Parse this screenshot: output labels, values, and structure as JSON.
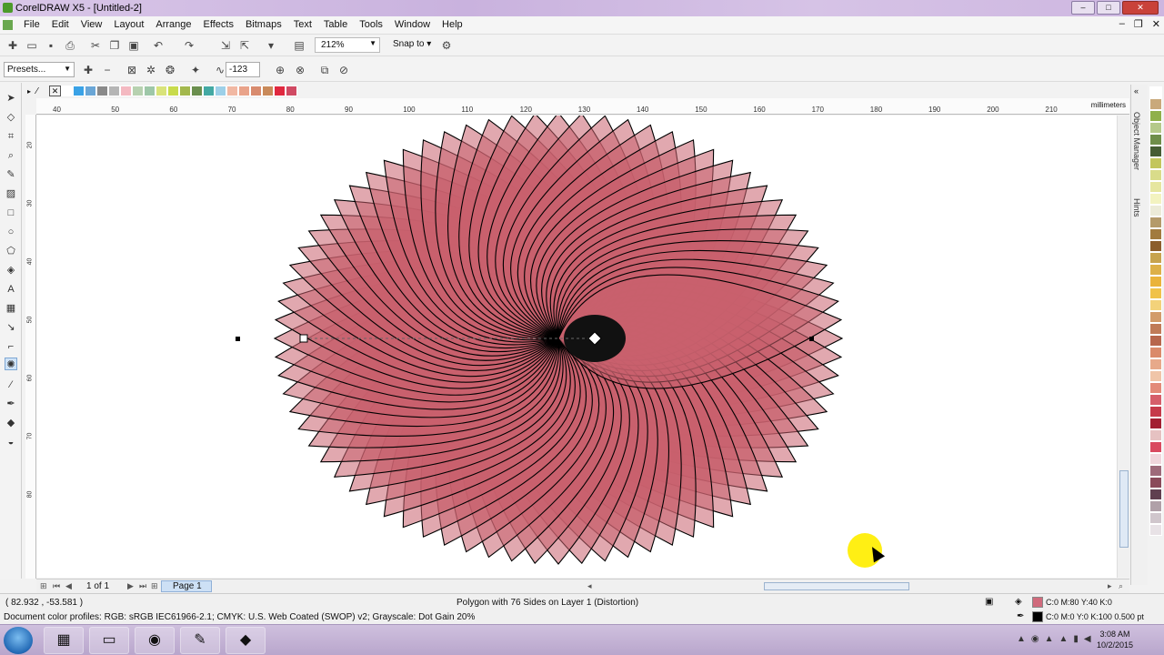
{
  "window": {
    "title": "CorelDRAW X5 - [Untitled-2]"
  },
  "menu": [
    "File",
    "Edit",
    "View",
    "Layout",
    "Arrange",
    "Effects",
    "Bitmaps",
    "Text",
    "Table",
    "Tools",
    "Window",
    "Help"
  ],
  "standard_toolbar": {
    "zoom": "212%",
    "snap_to": "Snap to"
  },
  "property_bar": {
    "presets": "Presets...",
    "distortion_value": "-123"
  },
  "rulers": {
    "unit": "millimeters",
    "h_ticks": [
      "40",
      "50",
      "60",
      "70",
      "80",
      "90",
      "100",
      "110",
      "120",
      "130",
      "140",
      "150",
      "160",
      "170",
      "180",
      "190",
      "200",
      "210"
    ],
    "v_ticks": [
      "20",
      "30",
      "40",
      "50",
      "60",
      "70",
      "80"
    ]
  },
  "document_palette": [
    "#ffffff",
    "#3aa2e6",
    "#6aa6d6",
    "#8a8a8a",
    "#b5b5b5",
    "#f4b9c1",
    "#b7d1b0",
    "#9ec7a8",
    "#d9e37a",
    "#c8db4c",
    "#a3b84d",
    "#6b8f4e",
    "#43a9a3",
    "#9dd0e8",
    "#f1b8a3",
    "#e9a38a",
    "#d88b6e",
    "#c98a5a",
    "#e0283f",
    "#d04a63"
  ],
  "color_palette": [
    "#ffffff",
    "#c9a97b",
    "#8fb04a",
    "#b5c98a",
    "#6f8e4a",
    "#465d34",
    "#c3c65c",
    "#d9dc8a",
    "#e6e6a0",
    "#f3f3c0",
    "#ecebd8",
    "#b49a6a",
    "#a17b3e",
    "#8c5e2c",
    "#c7a34e",
    "#ddb048",
    "#eab33a",
    "#f0c24a",
    "#f3d27a",
    "#d29b6a",
    "#c07b58",
    "#b7664c",
    "#da8a6a",
    "#e7a98a",
    "#f0c5a8",
    "#e38a78",
    "#d65e6a",
    "#c63a4a",
    "#a32032",
    "#e6c2c2",
    "#d94a60",
    "#f0d6dc",
    "#9e6a7a",
    "#8a4a5a",
    "#604050",
    "#b0a0a8",
    "#d0c6cc",
    "#e8e2e6"
  ],
  "pagebar": {
    "page_of": "1 of 1",
    "page_tab": "Page 1"
  },
  "status": {
    "coords": "( 82.932 , -53.581 )",
    "object_info": "Polygon with 76 Sides on Layer 1 (Distortion)",
    "profiles": "Document color profiles: RGB: sRGB IEC61966-2.1; CMYK: U.S. Web Coated (SWOP) v2; Grayscale: Dot Gain 20%",
    "fill": "C:0 M:80 Y:40 K:0",
    "outline": "C:0 M:0 Y:0 K:100  0.500 pt",
    "fill_color": "#d06a7c",
    "outline_color": "#000000"
  },
  "dockers": {
    "object_manager": "Object Manager",
    "hints": "Hints"
  },
  "shape": {
    "petals": 76,
    "fill": "#c8606e",
    "stroke": "#000000"
  },
  "taskbar": {
    "time": "3:08 AM",
    "date": "10/2/2015"
  }
}
